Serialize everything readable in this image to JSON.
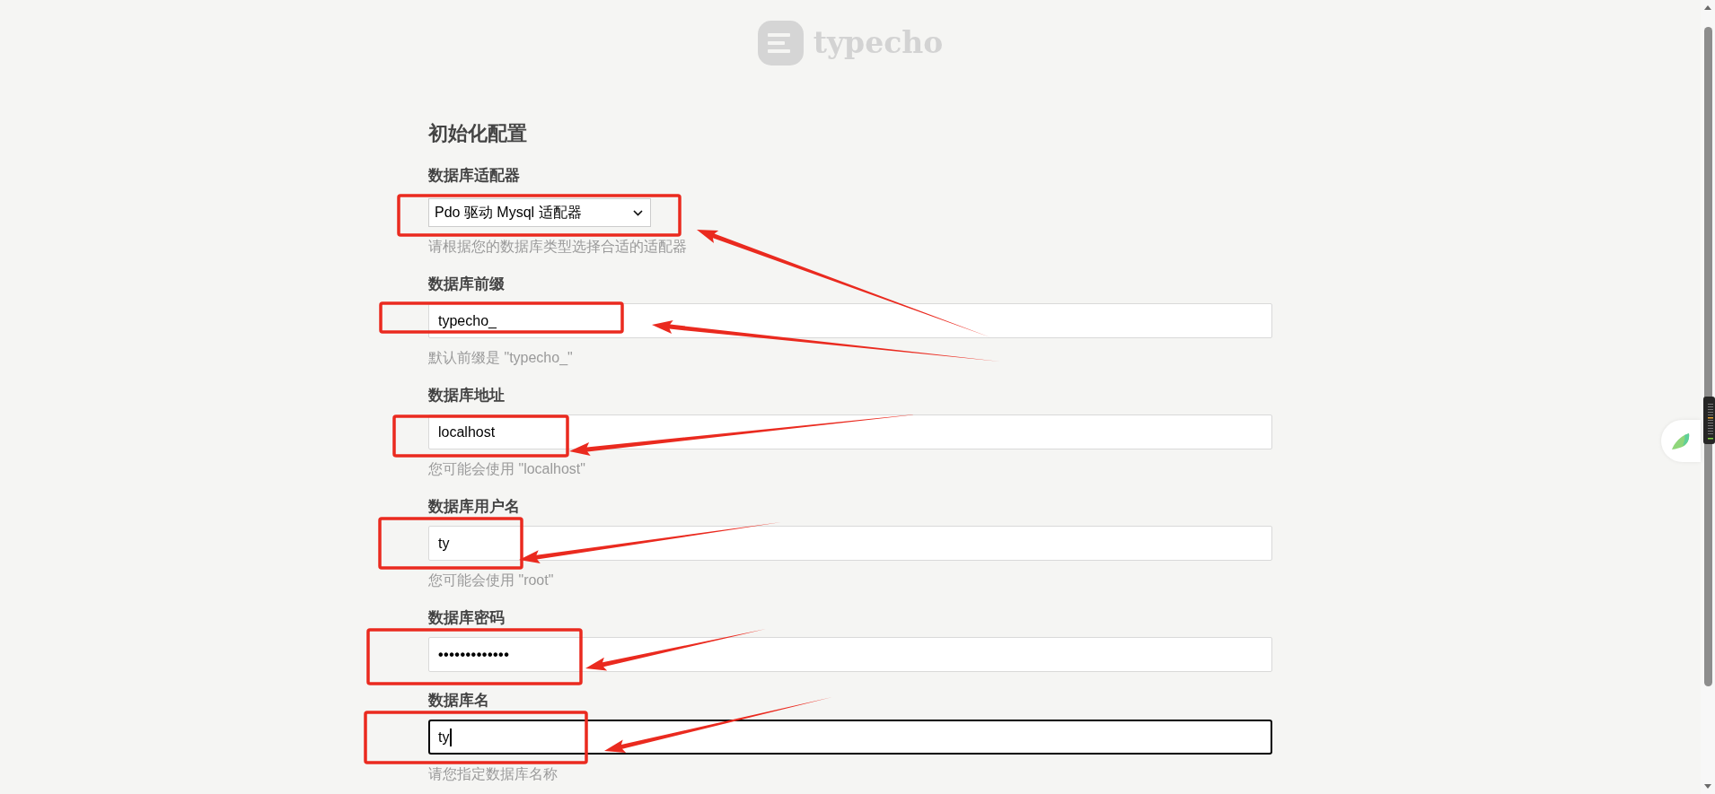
{
  "logo": {
    "text": "typecho"
  },
  "form": {
    "title": "初始化配置",
    "fields": [
      {
        "kind": "select",
        "label": "数据库适配器",
        "value": "Pdo 驱动 Mysql 适配器",
        "description": "请根据您的数据库类型选择合适的适配器",
        "focused": false,
        "annotated": true
      },
      {
        "kind": "text",
        "label": "数据库前缀",
        "value": "typecho_",
        "description": "默认前缀是 \"typecho_\"",
        "focused": false,
        "annotated": true
      },
      {
        "kind": "text",
        "label": "数据库地址",
        "value": "localhost",
        "description": "您可能会使用 \"localhost\"",
        "focused": false,
        "annotated": true
      },
      {
        "kind": "text",
        "label": "数据库用户名",
        "value": "ty",
        "description": "您可能会使用 \"root\"",
        "focused": false,
        "annotated": true
      },
      {
        "kind": "password",
        "label": "数据库密码",
        "value": "•••••••••••••",
        "focused": false,
        "annotated": true
      },
      {
        "kind": "text",
        "label": "数据库名",
        "value": "ty",
        "description": "请您指定数据库名称",
        "focused": true,
        "annotated": true
      }
    ]
  }
}
